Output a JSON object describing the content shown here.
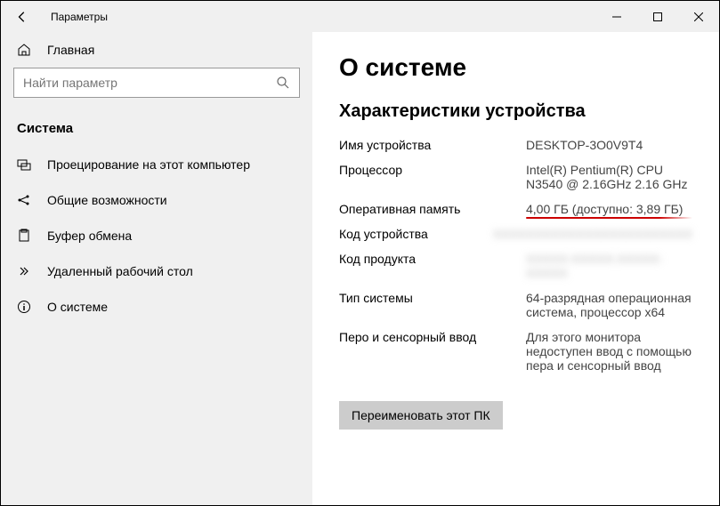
{
  "titlebar": {
    "title": "Параметры"
  },
  "sidebar": {
    "home": "Главная",
    "search_placeholder": "Найти параметр",
    "section": "Система",
    "items": [
      {
        "label": "Проецирование на этот компьютер"
      },
      {
        "label": "Общие возможности"
      },
      {
        "label": "Буфер обмена"
      },
      {
        "label": "Удаленный рабочий стол"
      },
      {
        "label": "О системе"
      }
    ]
  },
  "content": {
    "title": "О системе",
    "subtitle": "Характеристики устройства",
    "specs": {
      "device_name_label": "Имя устройства",
      "device_name_value": "DESKTOP-3O0V9T4",
      "processor_label": "Процессор",
      "processor_value": "Intel(R) Pentium(R) CPU N3540   @ 2.16GHz   2.16 GHz",
      "ram_label": "Оперативная память",
      "ram_value": "4,00 ГБ (доступно: 3,89 ГБ)",
      "device_id_label": "Код устройства",
      "device_id_value": "XXXXXXXXXXXXXXXXXXXXXXXX",
      "product_id_label": "Код продукта",
      "product_id_value": "XXXXX-XXXXX-XXXXX-XXXXX",
      "system_type_label": "Тип системы",
      "system_type_value": "64-разрядная операционная система, процессор x64",
      "pen_touch_label": "Перо и сенсорный ввод",
      "pen_touch_value": "Для этого монитора недоступен ввод с помощью пера и сенсорный ввод"
    },
    "rename_button": "Переименовать этот ПК"
  }
}
